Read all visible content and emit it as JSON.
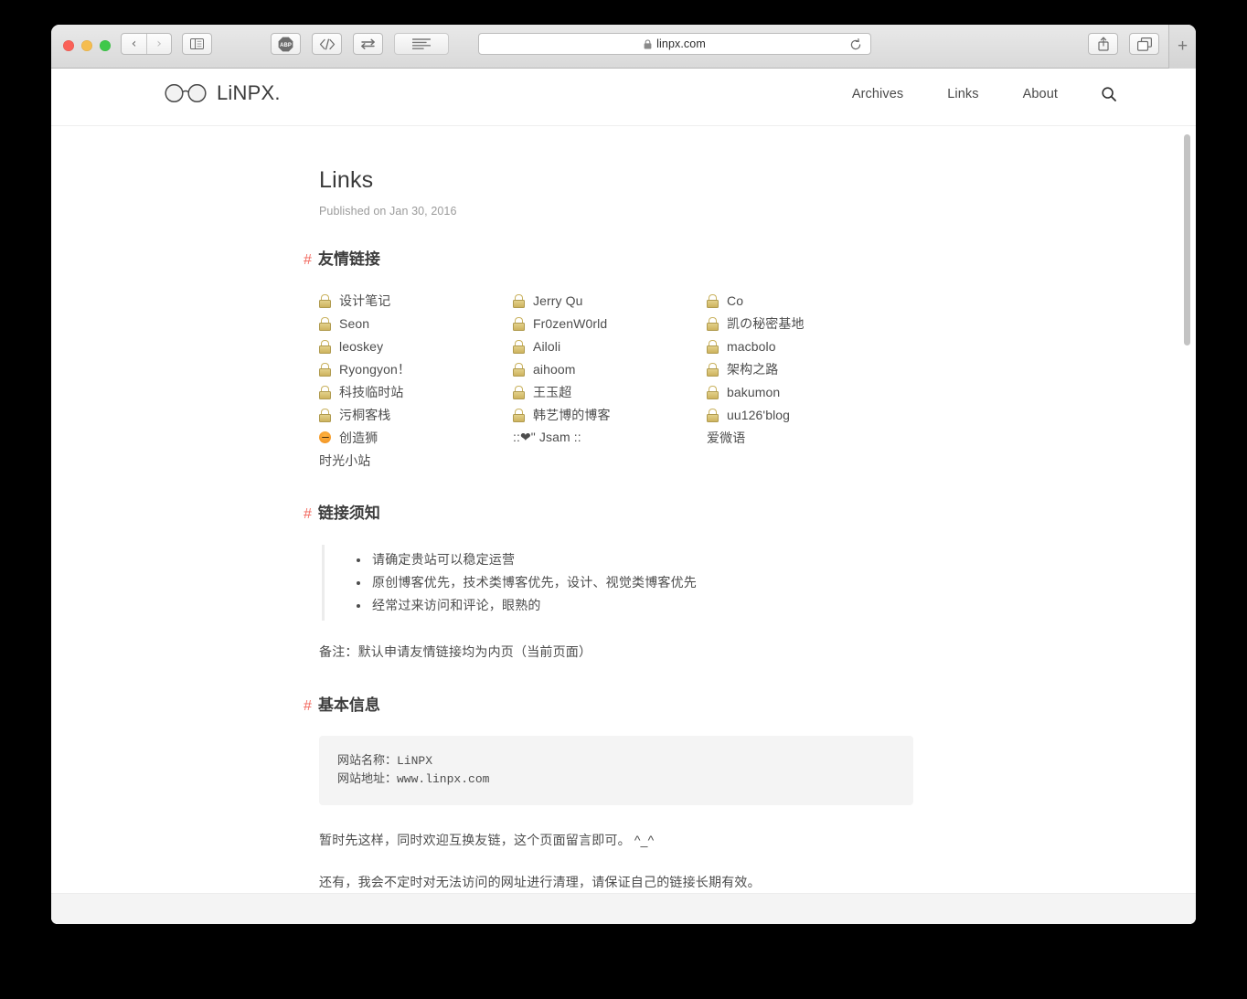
{
  "browser": {
    "url": "linpx.com",
    "lock_icon": "lock-icon",
    "back_label": "‹",
    "forward_label": "›",
    "sidebar_icon": "sidebar-icon",
    "adblock_label": "ABP",
    "devtools_label": "</>",
    "swap_icon": "swap-arrows-icon",
    "reader_icon": "reader-lines-icon",
    "share_icon": "share-icon",
    "tabs_icon": "tab-overview-icon",
    "reload_icon": "reload-icon",
    "new_tab_label": "+"
  },
  "site": {
    "logo_text": "LiNPX.",
    "logo_icon": "glasses-icon",
    "nav": [
      {
        "label": "Archives"
      },
      {
        "label": "Links"
      },
      {
        "label": "About"
      }
    ],
    "search_icon": "search-icon"
  },
  "post": {
    "title": "Links",
    "date": "Published on Jan 30, 2016"
  },
  "sections": {
    "friend_links_heading": "友情链接",
    "notice_heading": "链接须知",
    "basic_info_heading": "基本信息",
    "hash": "#"
  },
  "friend_links": [
    {
      "name": "设计笔记",
      "icon": "lock"
    },
    {
      "name": "Jerry Qu",
      "icon": "lock"
    },
    {
      "name": "Co",
      "icon": "lock"
    },
    {
      "name": "Seon",
      "icon": "lock"
    },
    {
      "name": "Fr0zenW0rld",
      "icon": "lock"
    },
    {
      "name": "凯の秘密基地",
      "icon": "lock"
    },
    {
      "name": "leoskey",
      "icon": "lock"
    },
    {
      "name": "Ailoli",
      "icon": "lock"
    },
    {
      "name": "macbolo",
      "icon": "lock"
    },
    {
      "name": "Ryongyon！",
      "icon": "lock"
    },
    {
      "name": "aihoom",
      "icon": "lock"
    },
    {
      "name": "架构之路",
      "icon": "lock"
    },
    {
      "name": "科技临时站",
      "icon": "lock"
    },
    {
      "name": "王玉超",
      "icon": "lock"
    },
    {
      "name": "bakumon",
      "icon": "lock"
    },
    {
      "name": "污桐客栈",
      "icon": "lock"
    },
    {
      "name": "韩艺博的博客",
      "icon": "lock"
    },
    {
      "name": "uu126'blog",
      "icon": "lock"
    },
    {
      "name": "创造狮",
      "icon": "cat"
    },
    {
      "name": "::❤\" Jsam ::",
      "icon": "none"
    },
    {
      "name": "爱微语",
      "icon": "none"
    },
    {
      "name": "时光小站",
      "icon": "none"
    },
    {
      "name": "",
      "icon": "none"
    },
    {
      "name": "",
      "icon": "none"
    }
  ],
  "notice_items": [
    "请确定贵站可以稳定运营",
    "原创博客优先，技术类博客优先，设计、视觉类博客优先",
    "经常过来访问和评论，眼熟的"
  ],
  "note_paragraph": "备注：默认申请友情链接均为内页（当前页面）",
  "code_block": "网站名称：LiNPX\n网站地址：www.linpx.com",
  "closing_paragraphs": [
    "暂时先这样，同时欢迎互换友链，这个页面留言即可。 ^_^",
    "还有，我会不定时对无法访问的网址进行清理，请保证自己的链接长期有效。"
  ],
  "colors": {
    "accent_hash": "#f2685e",
    "text": "#4d4d4d",
    "muted": "#9b9b9b",
    "code_bg": "#f4f4f4"
  }
}
